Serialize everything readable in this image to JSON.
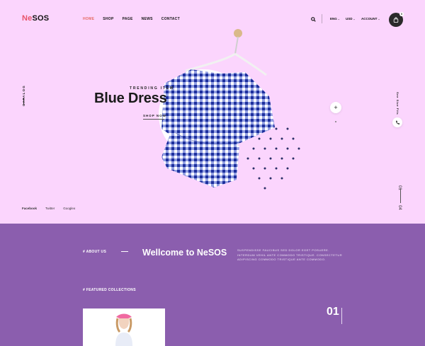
{
  "header": {
    "logo_prefix": "Ne",
    "logo_suffix": "SOS",
    "nav": [
      "HOME",
      "SHOP",
      "PAGE",
      "NEWS",
      "CONTACT"
    ],
    "currency": [
      "ENG",
      "USD"
    ],
    "account_label": "ACCOUNT",
    "cart_count": "0"
  },
  "hero": {
    "catalog_label": "CATALOG",
    "trending_label": "TRENDING ITEM",
    "title": "Blue Dress",
    "cta": "SHOP NOW",
    "size_guide": "See Size Fits",
    "slide_current": "01",
    "slide_total": "04",
    "social": [
      "Facebook",
      "Twitter",
      "Googleⅹ"
    ]
  },
  "about": {
    "label": "# ABOUT US",
    "heading": "Wellcome to NeSOS",
    "text": "SUSPENDISSE FAUCIBUS SED DOLOR EGET POSUERE. INTERDUM VEHIL ANTE COMMODO TRISTIQUE. CONSECTETUR ADIPISCING COMMODO TRISTIQUE ANTE COMMODO."
  },
  "featured": {
    "label": "# FEATURED COLLECTIONS",
    "number": "01"
  }
}
